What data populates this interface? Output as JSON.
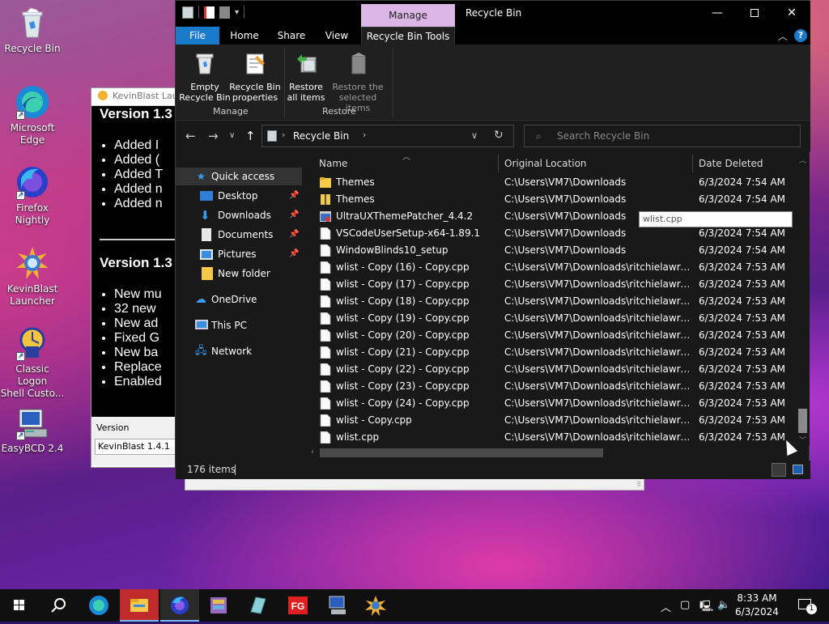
{
  "desktop": {
    "icons": [
      {
        "label_lines": [
          "Recycle Bin"
        ],
        "icon": "recycle-bin-icon"
      },
      {
        "label_lines": [
          "Microsoft",
          "Edge"
        ],
        "icon": "edge-icon"
      },
      {
        "label_lines": [
          "Firefox",
          "Nightly"
        ],
        "icon": "firefox-nightly-icon"
      },
      {
        "label_lines": [
          "KevinBlast",
          "Launcher"
        ],
        "icon": "kevinblast-icon"
      },
      {
        "label_lines": [
          "Classic Logon",
          "Shell Custo..."
        ],
        "icon": "classic-logon-icon"
      },
      {
        "label_lines": [
          "EasyBCD 2.4"
        ],
        "icon": "easybcd-icon"
      }
    ]
  },
  "background_window": {
    "title": "KevinBlast Lau",
    "heading1": "Version 1.3",
    "list1": [
      "Added I",
      "Added (",
      "Added T",
      "Added n",
      "Added n"
    ],
    "heading2": "Version 1.3",
    "list2": [
      "New mu",
      "32 new",
      "New ad",
      "Fixed G",
      "New ba",
      "Replace",
      "Enabled"
    ],
    "version_label": "Version",
    "version_value": "KevinBlast 1.4.1"
  },
  "explorer": {
    "window_title": "Recycle Bin",
    "contextual_tab": "Manage",
    "tabs": [
      "File",
      "Home",
      "Share",
      "View",
      "Recycle Bin Tools"
    ],
    "ribbon": {
      "empty_bin": [
        "Empty",
        "Recycle Bin"
      ],
      "bin_properties": [
        "Recycle Bin",
        "properties"
      ],
      "restore_all": [
        "Restore",
        "all items"
      ],
      "restore_selected": [
        "Restore the",
        "selected items"
      ],
      "group_manage": "Manage",
      "group_restore": "Restore"
    },
    "address_path": "Recycle Bin",
    "search_placeholder": "Search Recycle Bin",
    "nav": {
      "quick_access": "Quick access",
      "items": [
        "Desktop",
        "Downloads",
        "Documents",
        "Pictures",
        "New folder"
      ],
      "onedrive": "OneDrive",
      "this_pc": "This PC",
      "network": "Network"
    },
    "columns": [
      "Name",
      "Original Location",
      "Date Deleted"
    ],
    "files": [
      {
        "name": "Themes",
        "location": "C:\\Users\\VM7\\Downloads",
        "date": "6/3/2024 7:54 AM",
        "kind": "folder"
      },
      {
        "name": "Themes",
        "location": "C:\\Users\\VM7\\Downloads",
        "date": "6/3/2024 7:54 AM",
        "kind": "zip"
      },
      {
        "name": "UltraUXThemePatcher_4.4.2",
        "location": "C:\\Users\\VM7\\Downloads",
        "date": "",
        "kind": "exe"
      },
      {
        "name": "VSCodeUserSetup-x64-1.89.1",
        "location": "C:\\Users\\VM7\\Downloads",
        "date": "6/3/2024 7:54 AM",
        "kind": "file"
      },
      {
        "name": "WindowBlinds10_setup",
        "location": "C:\\Users\\VM7\\Downloads",
        "date": "6/3/2024 7:54 AM",
        "kind": "file"
      },
      {
        "name": "wlist - Copy (16) - Copy.cpp",
        "location": "C:\\Users\\VM7\\Downloads\\ritchielawrenc...",
        "date": "6/3/2024 7:53 AM",
        "kind": "file"
      },
      {
        "name": "wlist - Copy (17) - Copy.cpp",
        "location": "C:\\Users\\VM7\\Downloads\\ritchielawrenc...",
        "date": "6/3/2024 7:53 AM",
        "kind": "file"
      },
      {
        "name": "wlist - Copy (18) - Copy.cpp",
        "location": "C:\\Users\\VM7\\Downloads\\ritchielawrenc...",
        "date": "6/3/2024 7:53 AM",
        "kind": "file"
      },
      {
        "name": "wlist - Copy (19) - Copy.cpp",
        "location": "C:\\Users\\VM7\\Downloads\\ritchielawrenc...",
        "date": "6/3/2024 7:53 AM",
        "kind": "file"
      },
      {
        "name": "wlist - Copy (20) - Copy.cpp",
        "location": "C:\\Users\\VM7\\Downloads\\ritchielawrenc...",
        "date": "6/3/2024 7:53 AM",
        "kind": "file"
      },
      {
        "name": "wlist - Copy (21) - Copy.cpp",
        "location": "C:\\Users\\VM7\\Downloads\\ritchielawrenc...",
        "date": "6/3/2024 7:53 AM",
        "kind": "file"
      },
      {
        "name": "wlist - Copy (22) - Copy.cpp",
        "location": "C:\\Users\\VM7\\Downloads\\ritchielawrenc...",
        "date": "6/3/2024 7:53 AM",
        "kind": "file"
      },
      {
        "name": "wlist - Copy (23) - Copy.cpp",
        "location": "C:\\Users\\VM7\\Downloads\\ritchielawrenc...",
        "date": "6/3/2024 7:53 AM",
        "kind": "file"
      },
      {
        "name": "wlist - Copy (24) - Copy.cpp",
        "location": "C:\\Users\\VM7\\Downloads\\ritchielawrenc...",
        "date": "6/3/2024 7:53 AM",
        "kind": "file"
      },
      {
        "name": "wlist - Copy.cpp",
        "location": "C:\\Users\\VM7\\Downloads\\ritchielawrenc...",
        "date": "6/3/2024 7:53 AM",
        "kind": "file"
      },
      {
        "name": "wlist.cpp",
        "location": "C:\\Users\\VM7\\Downloads\\ritchielawrenc...",
        "date": "6/3/2024 7:53 AM",
        "kind": "file"
      }
    ],
    "tooltip": "wlist.cpp",
    "status_count": "176 items"
  },
  "taskbar": {
    "time": "8:33 AM",
    "date": "6/3/2024",
    "notification_count": "1",
    "apps": [
      "start-icon",
      "search-icon",
      "edge-icon",
      "file-explorer-icon",
      "firefox-nightly-icon",
      "winrar-icon",
      "app-icon",
      "fg-icon",
      "easybcd-icon",
      "kevinblast-icon"
    ]
  },
  "colors": {
    "manage_tab": "#dcb6e6",
    "file_tab": "#1979ca",
    "selected_nav": "#333333",
    "explorer_bg": "#191919"
  }
}
